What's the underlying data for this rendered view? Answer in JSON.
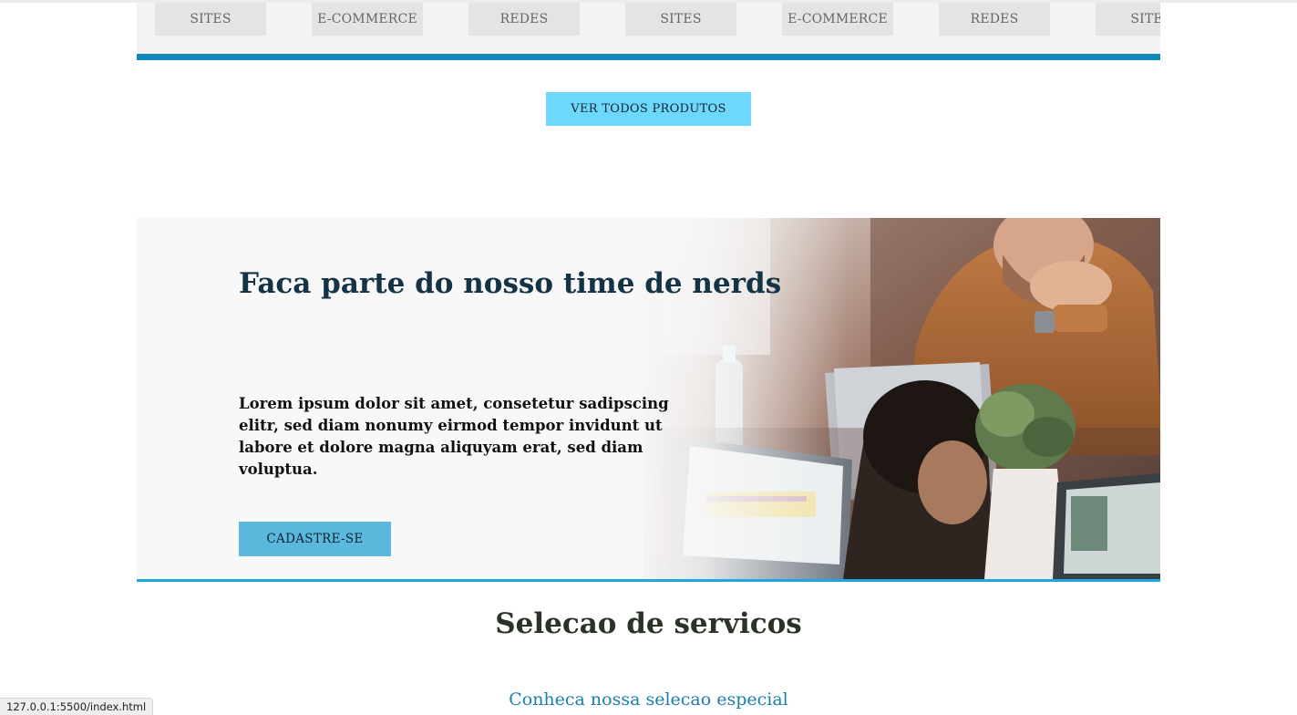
{
  "categories": [
    "SITES",
    "E-COMMERCE",
    "REDES",
    "SITES",
    "E-COMMERCE",
    "REDES",
    "SITES"
  ],
  "products_button": "VER TODOS PRODUTOS",
  "hero": {
    "title": "Faca parte do nosso time de nerds",
    "text": "Lorem ipsum dolor sit amet, consetetur sadipscing elitr, sed diam nonumy eirmod tempor invidunt ut labore et dolore magna aliquyam erat, sed diam voluptua.",
    "button": "CADASTRE-SE"
  },
  "services": {
    "title": "Selecao de servicos",
    "subtitle": "Conheca nossa selecao especial"
  },
  "status_bar": {
    "url": "127.0.0.1:5500/index.html"
  },
  "colors": {
    "accent_bar": "#1287be",
    "button_light": "#6dd8fc",
    "button_hero": "#5ab8dc",
    "title_dark": "#143344",
    "subtitle_link": "#1a7fab"
  }
}
